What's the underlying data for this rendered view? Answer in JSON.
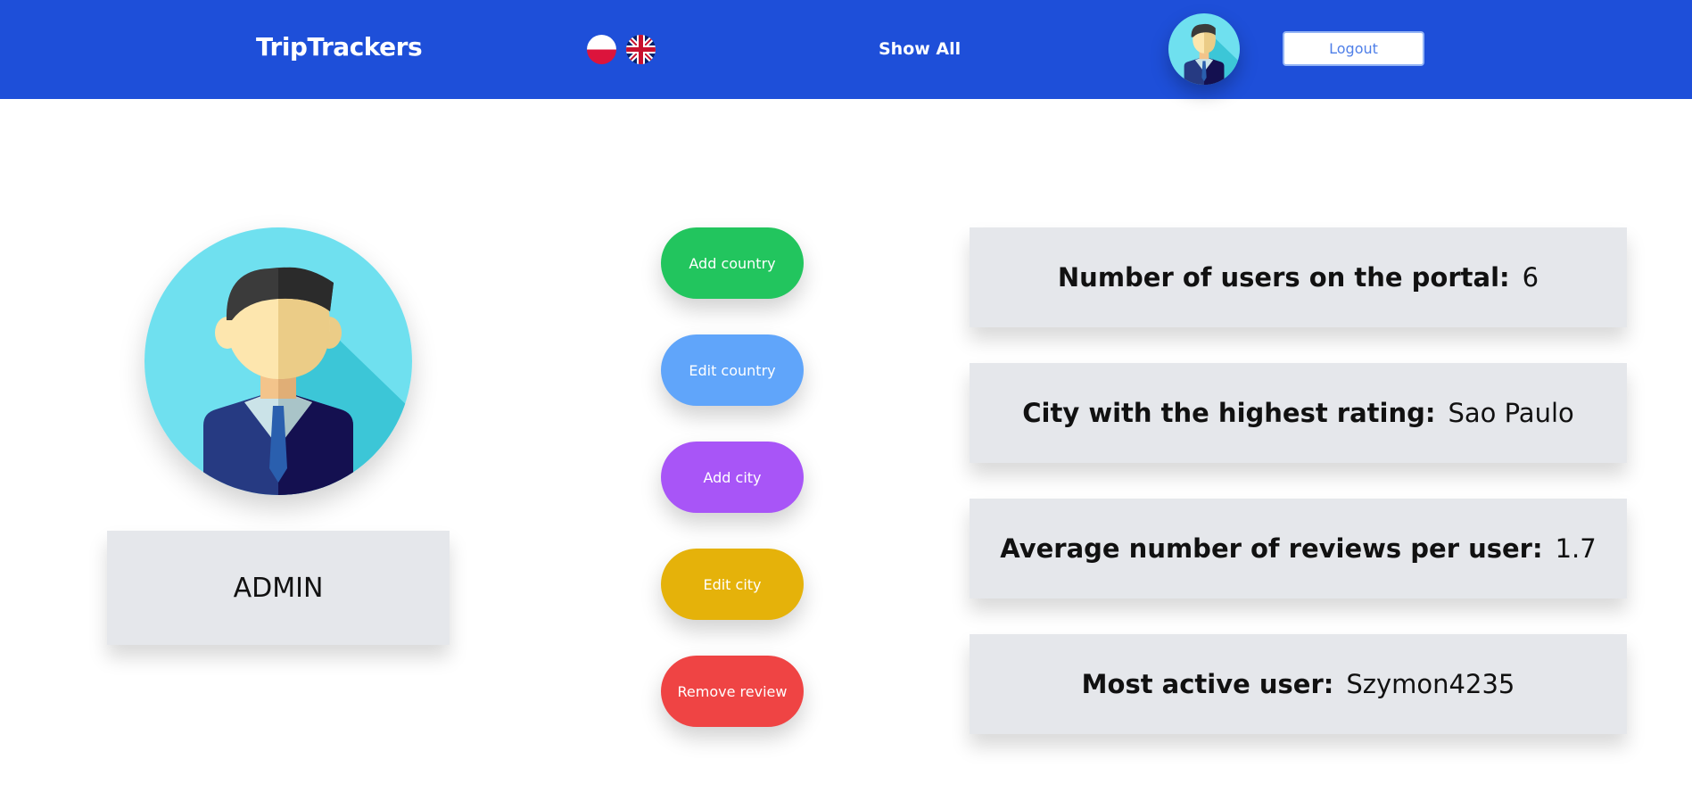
{
  "header": {
    "brand": "TripTrackers",
    "languages": [
      {
        "code": "pl",
        "icon": "poland-flag-icon"
      },
      {
        "code": "en",
        "icon": "uk-flag-icon"
      }
    ],
    "show_all_label": "Show All",
    "avatar_icon": "user-avatar-icon",
    "logout_label": "Logout"
  },
  "profile": {
    "avatar_icon": "admin-avatar-icon",
    "role": "ADMIN"
  },
  "actions": [
    {
      "label": "Add country",
      "color": "#22c55e"
    },
    {
      "label": "Edit country",
      "color": "#60a5fa"
    },
    {
      "label": "Add city",
      "color": "#a855f7"
    },
    {
      "label": "Edit city",
      "color": "#e5b20a"
    },
    {
      "label": "Remove review",
      "color": "#ef4444"
    }
  ],
  "stats": [
    {
      "label": "Number of users on the portal:",
      "value": "6"
    },
    {
      "label": "City with the highest rating:",
      "value": "Sao Paulo"
    },
    {
      "label": "Average number of reviews per user:",
      "value": "1.7"
    },
    {
      "label": "Most active user:",
      "value": "Szymon4235"
    }
  ],
  "colors": {
    "navbar": "#1e4fd9",
    "card": "#e5e7eb",
    "avatar_bg": "#6fe0ef"
  }
}
